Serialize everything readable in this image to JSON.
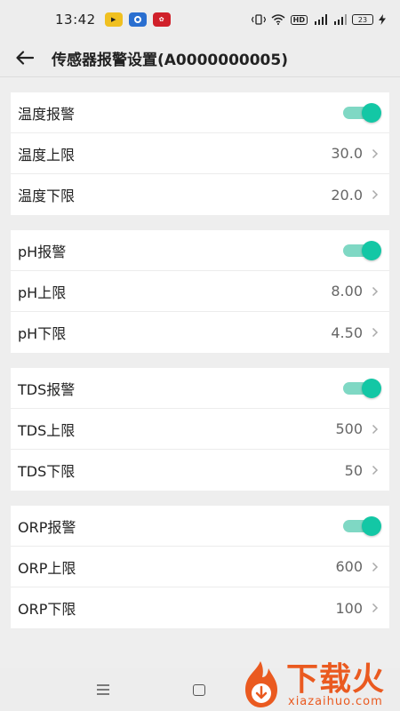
{
  "status_bar": {
    "time": "13:42",
    "app_icons": [
      "video-app-icon",
      "browser-app-icon",
      "map-app-icon"
    ],
    "hd_label": "HD",
    "battery": "23"
  },
  "app_bar": {
    "title": "传感器报警设置(A0000000005)"
  },
  "groups": [
    {
      "alarm": {
        "label": "温度报警",
        "enabled": true
      },
      "upper": {
        "label": "温度上限",
        "value": "30.0"
      },
      "lower": {
        "label": "温度下限",
        "value": "20.0"
      }
    },
    {
      "alarm": {
        "label": "pH报警",
        "enabled": true
      },
      "upper": {
        "label": "pH上限",
        "value": "8.00"
      },
      "lower": {
        "label": "pH下限",
        "value": "4.50"
      }
    },
    {
      "alarm": {
        "label": "TDS报警",
        "enabled": true
      },
      "upper": {
        "label": "TDS上限",
        "value": "500"
      },
      "lower": {
        "label": "TDS下限",
        "value": "50"
      }
    },
    {
      "alarm": {
        "label": "ORP报警",
        "enabled": true
      },
      "upper": {
        "label": "ORP上限",
        "value": "600"
      },
      "lower": {
        "label": "ORP下限",
        "value": "100"
      }
    }
  ],
  "colors": {
    "toggle_on": "#13c7a5",
    "toggle_track": "#7fd8c4",
    "watermark": "#ea5a20"
  },
  "watermark": {
    "title": "下载火",
    "subtitle": "xiazaihuo.com"
  }
}
